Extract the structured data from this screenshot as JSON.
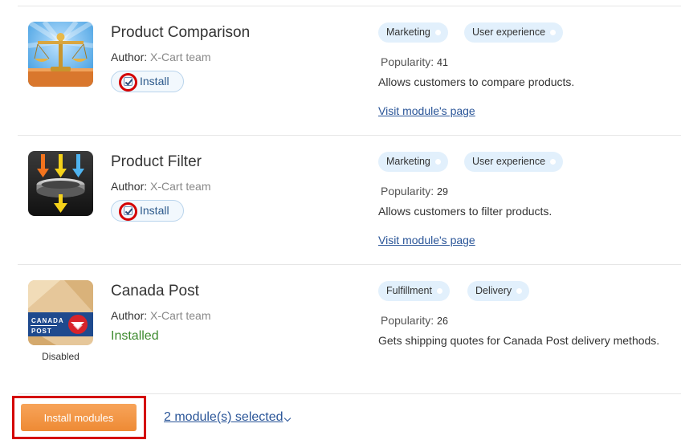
{
  "modules": [
    {
      "title": "Product Comparison",
      "author_label": "Author:",
      "author": "X-Cart team",
      "install_label": "Install",
      "tags": [
        "Marketing",
        "User experience"
      ],
      "popularity_label": "Popularity:",
      "popularity": "41",
      "description": "Allows customers to compare products.",
      "visit_label": "Visit module's page",
      "icon": "scales-icon"
    },
    {
      "title": "Product Filter",
      "author_label": "Author:",
      "author": "X-Cart team",
      "install_label": "Install",
      "tags": [
        "Marketing",
        "User experience"
      ],
      "popularity_label": "Popularity:",
      "popularity": "29",
      "description": "Allows customers to filter products.",
      "visit_label": "Visit module's page",
      "icon": "filter-icon"
    },
    {
      "title": "Canada Post",
      "author_label": "Author:",
      "author": "X-Cart team",
      "status": "Installed",
      "state": "Disabled",
      "tags": [
        "Fulfillment",
        "Delivery"
      ],
      "popularity_label": "Popularity:",
      "popularity": "26",
      "description": "Gets shipping quotes for Canada Post delivery methods.",
      "icon": "canada-post-icon",
      "logo_text_1": "CANADA",
      "logo_text_2": "POST"
    }
  ],
  "footer": {
    "install_button": "Install modules",
    "selected_link": "2 module(s) selected"
  },
  "colors": {
    "accent_orange": "#ee8a34",
    "link_blue": "#2a5598",
    "tag_bg": "#e2f0fc",
    "installed_green": "#3d8a2e",
    "highlight_red": "#d40000"
  }
}
